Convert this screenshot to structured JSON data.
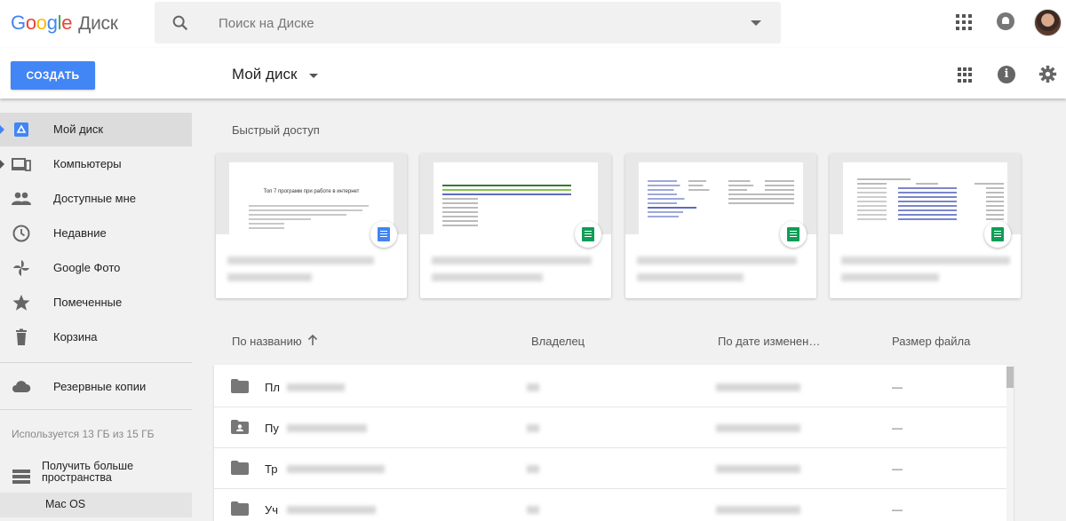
{
  "header": {
    "logo_letters": [
      "G",
      "o",
      "o",
      "g",
      "l",
      "e"
    ],
    "product": "Диск",
    "search_placeholder": "Поиск на Диске"
  },
  "toolbar": {
    "create_label": "СОЗДАТЬ",
    "title": "Мой диск"
  },
  "sidebar": {
    "items": [
      {
        "label": "Мой диск",
        "icon": "drive-icon"
      },
      {
        "label": "Компьютеры",
        "icon": "computers-icon"
      },
      {
        "label": "Доступные мне",
        "icon": "people-icon"
      },
      {
        "label": "Недавние",
        "icon": "clock-icon"
      },
      {
        "label": "Google Фото",
        "icon": "pinwheel-icon"
      },
      {
        "label": "Помеченные",
        "icon": "star-icon"
      },
      {
        "label": "Корзина",
        "icon": "trash-icon"
      },
      {
        "label": "Резервные копии",
        "icon": "cloud-icon"
      }
    ],
    "storage": "Используется 13 ГБ из 15 ГБ",
    "get_more": "Получить больше пространства",
    "macos": "Mac OS"
  },
  "quick_access": {
    "title": "Быстрый доступ",
    "cards": [
      {
        "type": "doc",
        "icon": "docs-icon",
        "preview_title": "Топ 7 программ при работе в интернет"
      },
      {
        "type": "sheet",
        "icon": "sheets-icon"
      },
      {
        "type": "sheet",
        "icon": "sheets-icon"
      },
      {
        "type": "sheet",
        "icon": "sheets-icon"
      }
    ]
  },
  "file_list": {
    "columns": [
      "По названию",
      "Владелец",
      "По дате изменен…",
      "Размер файла"
    ],
    "rows": [
      {
        "name": "Пл",
        "icon": "folder-icon",
        "size": "—"
      },
      {
        "name": "Пу",
        "icon": "shared-folder-icon",
        "size": "—"
      },
      {
        "name": "Тр",
        "icon": "folder-icon",
        "size": "—"
      },
      {
        "name": "Уч",
        "icon": "folder-icon",
        "size": "—"
      }
    ]
  },
  "colors": {
    "accent": "#4285f4",
    "sheets_green": "#0f9d58",
    "active_nav_bg": "#dcdcdc"
  }
}
